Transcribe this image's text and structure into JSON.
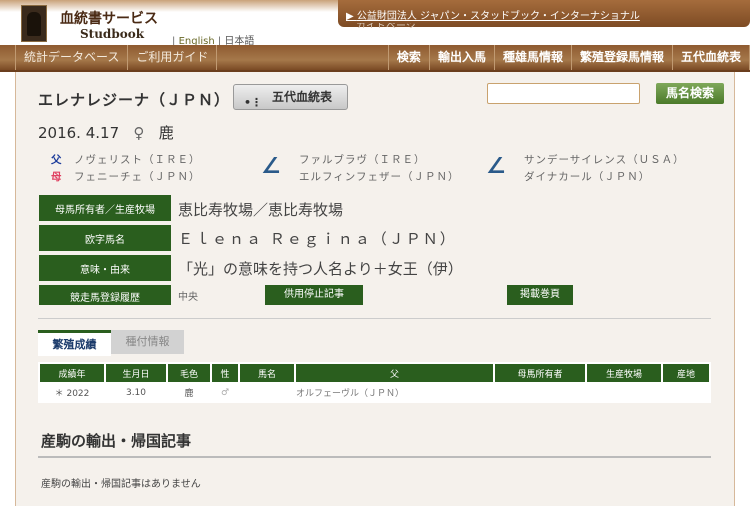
{
  "header": {
    "brand_jp": "血統書サービス",
    "brand_en": "Studbook",
    "lang_en": "English",
    "lang_ja": "日本語",
    "org_link": "公益財団法人 ジャパン・スタッドブック・インターナショナル",
    "guide_link": "ガイドページ"
  },
  "nav": {
    "left": [
      "統計データベース",
      "ご利用ガイド"
    ],
    "right": [
      "検索",
      "輸出入馬",
      "種雄馬情報",
      "繁殖登録馬情報",
      "五代血統表"
    ]
  },
  "horse": {
    "name": "エレナレジーナ（ＪＰＮ）",
    "pedigree_button": "五代血統表",
    "search_placeholder": "",
    "search_button": "馬名検索",
    "birth": "2016. 4.17",
    "sex_symbol": "♀",
    "color": "鹿"
  },
  "pedigree": {
    "sire_label": "父",
    "dam_label": "母",
    "sire": "ノヴェリスト（ＩＲＥ）",
    "dam": "フェニーチェ（ＪＰＮ）",
    "sire_sire": "ファルブラヴ（ＩＲＥ）",
    "sire_dam": "エルフィンフェザー（ＪＰＮ）",
    "dam_sire": "サンデーサイレンス（ＵＳＡ）",
    "dam_dam": "ダイナカール（ＪＰＮ）"
  },
  "info": {
    "owner_label": "母馬所有者／生産牧場",
    "owner": "恵比寿牧場／恵比寿牧場",
    "roman_label": "欧字馬名",
    "roman": "Ｅｌｅｎａ Ｒｅｇｉｎａ（ＪＰＮ）",
    "meaning_label": "意味・由来",
    "meaning": "「光」の意味を持つ人名より＋女王（伊）",
    "race_label": "競走馬登録履歴",
    "race": "中央",
    "suspend_label": "供用停止記事",
    "page_label": "掲載巻頁"
  },
  "tabs": [
    "繁殖成績",
    "種付情報"
  ],
  "table": {
    "headers": [
      "成績年",
      "生月日",
      "毛色",
      "性",
      "馬名",
      "父",
      "母馬所有者",
      "生産牧場",
      "産地"
    ],
    "rows": [
      [
        "＊ 2022",
        "3.10",
        "鹿",
        "♂",
        "",
        "オルフェーヴル（ＪＰＮ）",
        "",
        "",
        ""
      ]
    ]
  },
  "export": {
    "title": "産駒の輸出・帰国記事",
    "empty": "産駒の輸出・帰国記事はありません"
  }
}
